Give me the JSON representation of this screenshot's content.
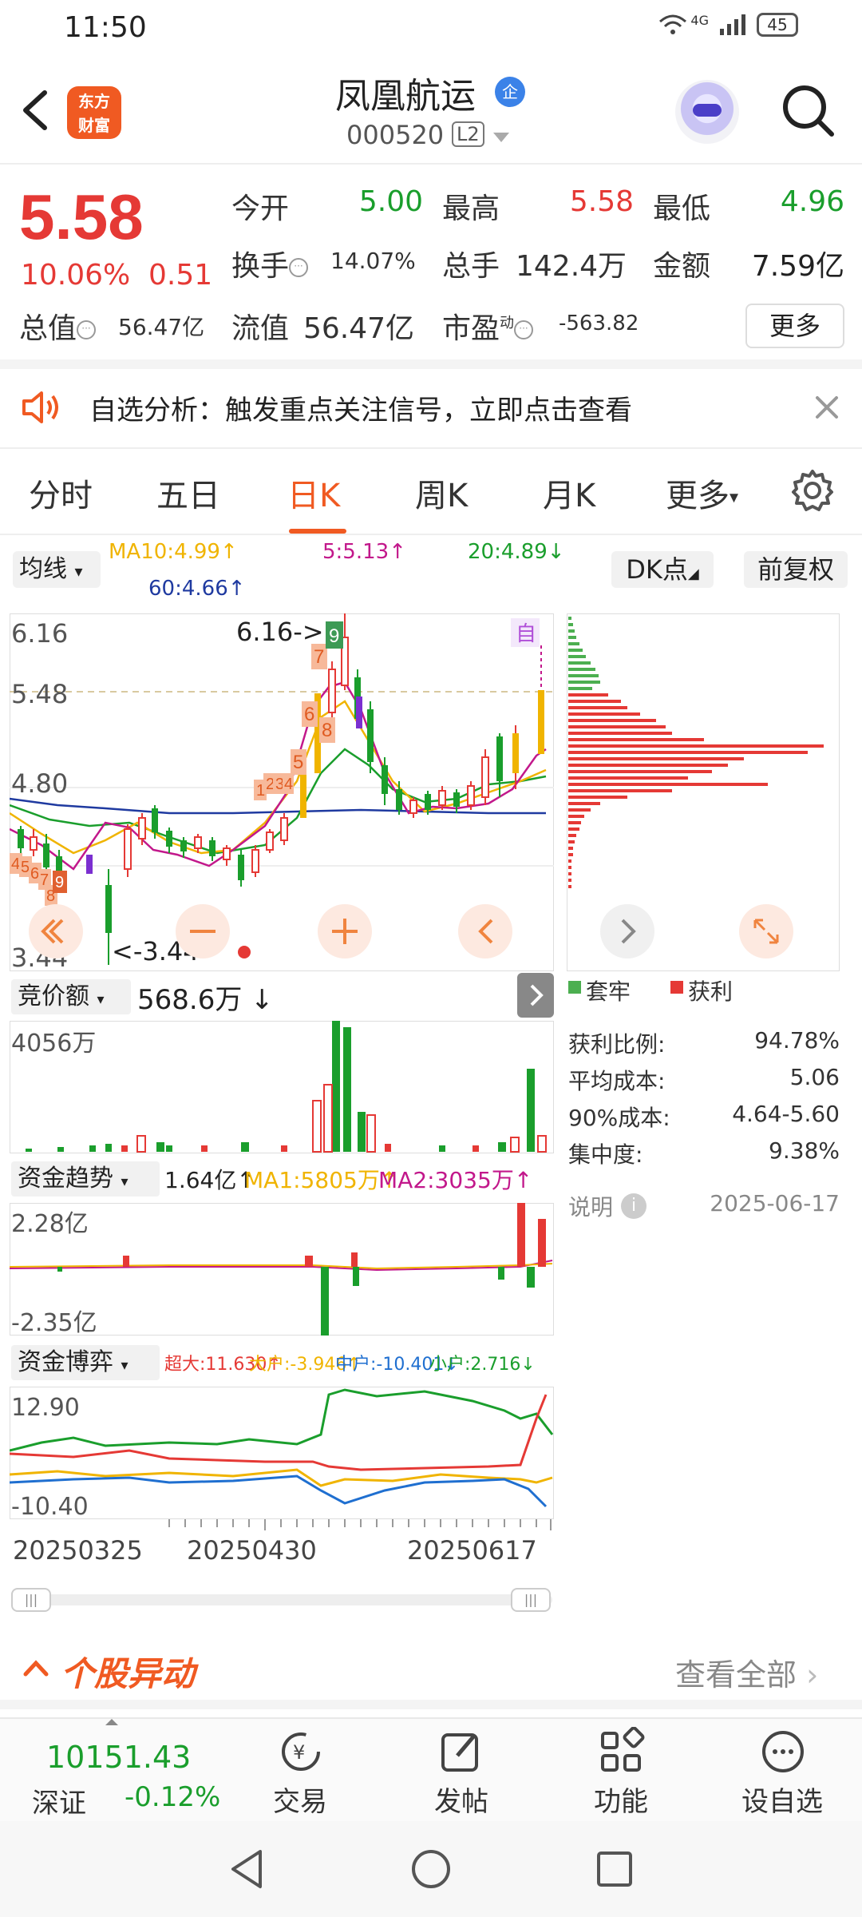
{
  "status": {
    "time": "11:50",
    "network": "4G",
    "battery": "45"
  },
  "header": {
    "logo_line1": "东方",
    "logo_line2": "财富",
    "stock_name": "凤凰航运",
    "badge": "企",
    "stock_code": "000520",
    "level": "L2"
  },
  "quote": {
    "price": "5.58",
    "change_pct": "10.06%",
    "change": "0.51",
    "open_label": "今开",
    "open": "5.00",
    "high_label": "最高",
    "high": "5.58",
    "low_label": "最低",
    "low": "4.96",
    "turnover_label": "换手",
    "turnover": "14.07%",
    "volume_label": "总手",
    "volume": "142.4万",
    "amount_label": "金额",
    "amount": "7.59亿",
    "mktcap_label": "总值",
    "mktcap": "56.47亿",
    "float_label": "流值",
    "float_cap": "56.47亿",
    "pe_label": "市盈",
    "pe_sup": "动",
    "pe": "-563.82",
    "more_label": "更多"
  },
  "notice": {
    "text": "自选分析：触发重点关注信号，立即点击查看"
  },
  "tabs": [
    "分时",
    "五日",
    "日K",
    "周K",
    "月K",
    "更多"
  ],
  "ma": {
    "selector": "均线",
    "ma10": "MA10:4.99↑",
    "ma5": "5:5.13↑",
    "ma20": "20:4.89↓",
    "ma60": "60:4.66↑",
    "dk_label": "DK点",
    "fq_label": "前复权"
  },
  "kline": {
    "y_top": "6.16",
    "y_mid1": "5.48",
    "y_mid2": "4.80",
    "y_low": "3.44",
    "high_marker": "6.16->",
    "low_marker": "<-3.44",
    "zi_tag": "自",
    "td_red": [
      "7",
      "6",
      "8",
      "5",
      "1",
      "2",
      "3",
      "4",
      "6",
      "7",
      "8",
      "4",
      "5",
      "6"
    ],
    "td_green": [
      "9"
    ],
    "td_green2": [
      "9"
    ]
  },
  "auction": {
    "selector": "竞价额",
    "value": "568.6万 ↓",
    "y_label": "4056万"
  },
  "fund_trend": {
    "selector": "资金趋势",
    "value": "1.64亿↑",
    "ma1": "MA1:5805万↑",
    "ma2": "MA2:3035万↑",
    "y_top": "2.28亿",
    "y_bottom": "-2.35亿"
  },
  "fund_game": {
    "selector": "资金博弈",
    "super": "超大:11.630↑",
    "large": "大户:-3.946↑",
    "medium": "中户:-10.401↓",
    "small": "小户:2.716↓",
    "y_top": "12.90",
    "y_bottom": "-10.40"
  },
  "dates": [
    "20250325",
    "20250430",
    "20250617"
  ],
  "chips": {
    "legend_trapped": "套牢",
    "legend_profit": "获利",
    "rows": [
      {
        "label": "获利比例:",
        "value": "94.78%"
      },
      {
        "label": "平均成本:",
        "value": "5.06"
      },
      {
        "label": "90%成本:",
        "value": "4.64-5.60"
      },
      {
        "label": "集中度:",
        "value": "9.38%"
      }
    ],
    "note_label": "说明",
    "date": "2025-06-17"
  },
  "movers": {
    "title": "个股异动",
    "view_all": "查看全部"
  },
  "bottom": {
    "index_value": "10151.43",
    "index_name": "深证",
    "index_change": "-0.12%",
    "nav": [
      "交易",
      "发帖",
      "功能",
      "设自选"
    ]
  },
  "colors": {
    "up": "#e53935",
    "down": "#1a9e2c",
    "accent": "#f05a22"
  }
}
